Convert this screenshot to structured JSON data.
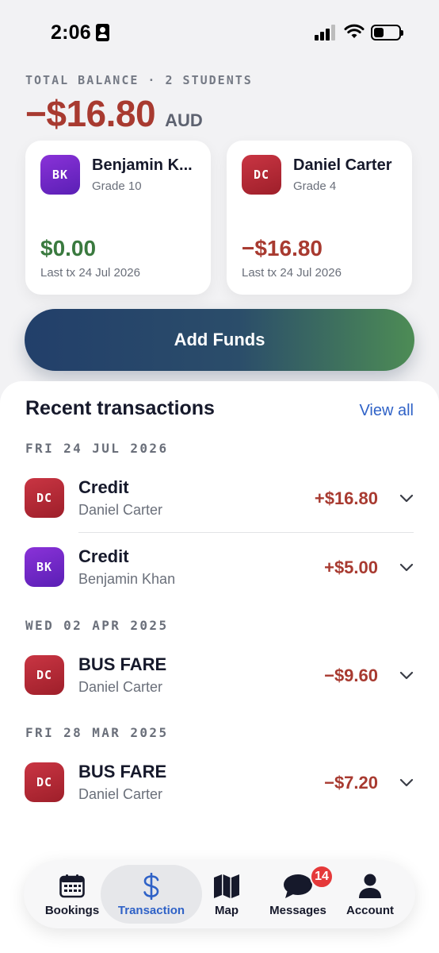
{
  "status_bar": {
    "time": "2:06",
    "icons": [
      "id-badge-icon",
      "signal-icon",
      "wifi-icon",
      "battery-icon"
    ]
  },
  "summary": {
    "label": "TOTAL BALANCE · 2 STUDENTS",
    "amount": "−$16.80",
    "currency": "AUD"
  },
  "students": [
    {
      "initials": "BK",
      "name": "Benjamin K...",
      "grade": "Grade 10",
      "balance": "$0.00",
      "last_tx": "Last tx 24 Jul 2026",
      "avatar_color": "#7a2bd0"
    },
    {
      "initials": "DC",
      "name": "Daniel Carter",
      "grade": "Grade 4",
      "balance": "−$16.80",
      "last_tx": "Last tx 24 Jul 2026",
      "avatar_color": "#b72a36"
    }
  ],
  "add_funds": {
    "label": "Add Funds"
  },
  "transactions": {
    "title": "Recent transactions",
    "view_all": "View all",
    "groups": [
      {
        "date": "FRI 24 JUL 2026",
        "items": [
          {
            "initials": "DC",
            "title": "Credit",
            "student": "Daniel Carter",
            "amount": "+$16.80"
          },
          {
            "initials": "BK",
            "title": "Credit",
            "student": "Benjamin Khan",
            "amount": "+$5.00"
          }
        ]
      },
      {
        "date": "WED 02 APR 2025",
        "items": [
          {
            "initials": "DC",
            "title": "BUS FARE",
            "student": "Daniel Carter",
            "amount": "−$9.60"
          }
        ]
      },
      {
        "date": "FRI 28 MAR 2025",
        "items": [
          {
            "initials": "DC",
            "title": "BUS FARE",
            "student": "Daniel Carter",
            "amount": "−$7.20"
          }
        ]
      }
    ]
  },
  "tab_bar": {
    "tabs": [
      {
        "label": "Bookings",
        "icon": "calendar-icon",
        "active": false
      },
      {
        "label": "Transaction",
        "icon": "dollar-icon",
        "active": true
      },
      {
        "label": "Map",
        "icon": "map-icon",
        "active": false
      },
      {
        "label": "Messages",
        "icon": "chat-bubble-icon",
        "active": false,
        "badge": "14"
      },
      {
        "label": "Account",
        "icon": "person-icon",
        "active": false
      }
    ]
  },
  "colors": {
    "negative": "#a83a30",
    "positive": "#3a7a3f",
    "accent": "#2f62c7",
    "badge": "#e5393a"
  }
}
